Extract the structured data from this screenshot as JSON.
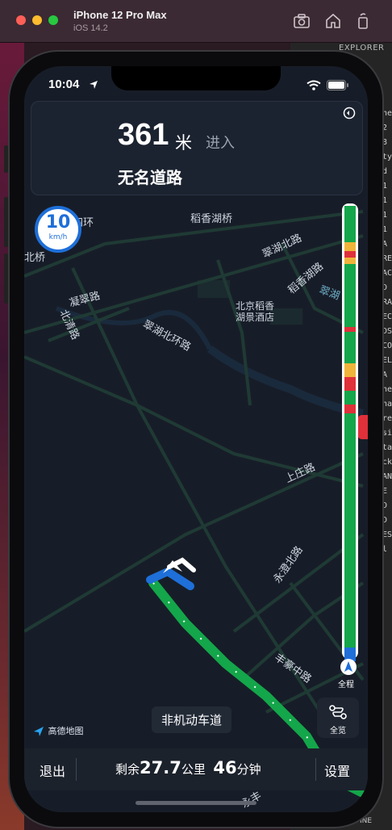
{
  "window": {
    "title": "iPhone 12 Pro Max",
    "subtitle": "iOS 14.2"
  },
  "editor": {
    "explorer_label": "EXPLORER",
    "side_text": "ne\n2\n8\nty\nd\n1\n1\n1\n1\nA\nRE\nAC\nD\nRA\nEC\nDS\nCO\nELF\nA\nhe\nna\nre\nsi\nta\nck\nAN\nE\nD\nD\nES\nl\n",
    "bottom_label": "INE"
  },
  "status": {
    "time": "10:04"
  },
  "guidance": {
    "distance": "361",
    "unit": "米",
    "action": "进入",
    "road": "无名道路"
  },
  "speed": {
    "value": "10",
    "unit": "km/h"
  },
  "map_labels": {
    "l1": "四环",
    "l2": "北桥",
    "l3": "稻香湖桥",
    "l4": "翠湖北路",
    "l5": "稻香湖路",
    "l6": "凝翠路",
    "l7": "北清路",
    "l8": "翠湖北环路",
    "l9": "北京稻香",
    "l10": "湖景酒店",
    "l11": "上庄路",
    "l12": "永澄北路",
    "l13": "丰豪中路",
    "l14": "翠湖",
    "l15": "永丰"
  },
  "traffic_bar": {
    "overview_label": "全程",
    "segments": [
      {
        "color": "#14a64a",
        "frac": 0.08
      },
      {
        "color": "#f0b43a",
        "frac": 0.02
      },
      {
        "color": "#e0303a",
        "frac": 0.015
      },
      {
        "color": "#f0b43a",
        "frac": 0.015
      },
      {
        "color": "#14a64a",
        "frac": 0.14
      },
      {
        "color": "#e0303a",
        "frac": 0.01
      },
      {
        "color": "#14a64a",
        "frac": 0.07
      },
      {
        "color": "#f0b43a",
        "frac": 0.03
      },
      {
        "color": "#e0303a",
        "frac": 0.03
      },
      {
        "color": "#14a64a",
        "frac": 0.03
      },
      {
        "color": "#e0303a",
        "frac": 0.02
      },
      {
        "color": "#14a64a",
        "frac": 0.52
      },
      {
        "color": "#1e6fd9",
        "frac": 0.03
      }
    ]
  },
  "full_view_button": {
    "label": "全览"
  },
  "lane_tip": "非机动车道",
  "logo": "高德地图",
  "bottom_bar": {
    "exit": "退出",
    "remaining_prefix": "剩余",
    "distance": "27.7",
    "distance_unit": "公里",
    "time": "46",
    "time_unit": "分钟",
    "settings": "设置"
  }
}
